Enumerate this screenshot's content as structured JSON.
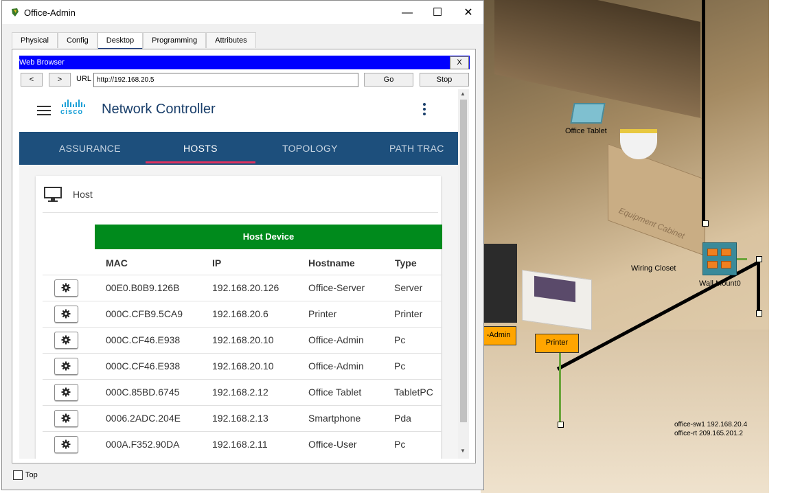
{
  "window": {
    "title": "Office-Admin",
    "minimize": "—",
    "maximize": "☐",
    "close": "✕"
  },
  "tabs": [
    {
      "label": "Physical"
    },
    {
      "label": "Config"
    },
    {
      "label": "Desktop"
    },
    {
      "label": "Programming"
    },
    {
      "label": "Attributes"
    }
  ],
  "active_tab": "Desktop",
  "web_browser": {
    "title": "Web Browser",
    "close_label": "X",
    "back_label": "<",
    "forward_label": ">",
    "url_label": "URL",
    "url_value": "http://192.168.20.5",
    "go_label": "Go",
    "stop_label": "Stop"
  },
  "network_controller": {
    "brand": "cisco",
    "title": "Network Controller",
    "nav": [
      {
        "label": "ASSURANCE"
      },
      {
        "label": "HOSTS"
      },
      {
        "label": "TOPOLOGY"
      },
      {
        "label": "PATH TRAC"
      }
    ],
    "active_nav": "HOSTS",
    "card_title": "Host",
    "banner": "Host Device",
    "columns": {
      "mac": "MAC",
      "ip": "IP",
      "hostname": "Hostname",
      "type": "Type"
    },
    "rows": [
      {
        "mac": "00E0.B0B9.126B",
        "ip": "192.168.20.126",
        "hostname": "Office-Server",
        "type": "Server"
      },
      {
        "mac": "000C.CFB9.5CA9",
        "ip": "192.168.20.6",
        "hostname": "Printer",
        "type": "Printer"
      },
      {
        "mac": "000C.CF46.E938",
        "ip": "192.168.20.10",
        "hostname": "Office-Admin",
        "type": "Pc"
      },
      {
        "mac": "000C.CF46.E938",
        "ip": "192.168.20.10",
        "hostname": "Office-Admin",
        "type": "Pc"
      },
      {
        "mac": "000C.85BD.6745",
        "ip": "192.168.2.12",
        "hostname": "Office Tablet",
        "type": "TabletPC"
      },
      {
        "mac": "0006.2ADC.204E",
        "ip": "192.168.2.13",
        "hostname": "Smartphone",
        "type": "Pda"
      },
      {
        "mac": "000A.F352.90DA",
        "ip": "192.168.2.11",
        "hostname": "Office-User",
        "type": "Pc"
      }
    ]
  },
  "footer": {
    "top_label": "Top"
  },
  "workspace": {
    "office_tablet": "Office Tablet",
    "cabinet": "Equipment Cabinet",
    "wiring_closet": "Wiring Closet",
    "wall_mount": "Wall Mount0",
    "admin_tag": "-Admin",
    "printer_tag": "Printer",
    "info_line1": "office-sw1 192.168.20.4",
    "info_line2": "office-rt 209.165.201.2"
  },
  "colors": {
    "titlebar_blue": "#0000ff",
    "nav_blue": "#1d4f7c",
    "banner_green": "#008a1c",
    "underline_pink": "#e0325f",
    "tag_orange": "#ffa500"
  }
}
